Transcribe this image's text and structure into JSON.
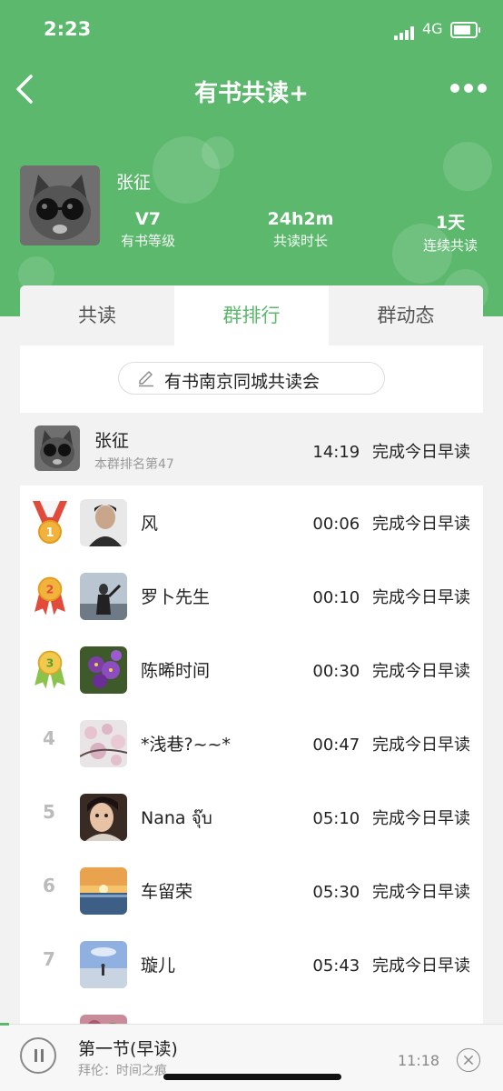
{
  "status_bar": {
    "time": "2:23",
    "network": "4G"
  },
  "nav": {
    "title": "有书共读+"
  },
  "profile": {
    "name": "张征",
    "stats": [
      {
        "value": "V7",
        "label": "有书等级"
      },
      {
        "value": "24h2m",
        "label": "共读时长"
      },
      {
        "value": "1天",
        "label": "连续共读"
      }
    ]
  },
  "tabs": [
    {
      "label": "共读",
      "active": false
    },
    {
      "label": "群排行",
      "active": true
    },
    {
      "label": "群动态",
      "active": false
    }
  ],
  "group_name": "有书南京同城共读会",
  "self_row": {
    "name": "张征",
    "rank_text": "本群排名第47",
    "time": "14:19",
    "status": "完成今日早读"
  },
  "ranking": [
    {
      "rank": "1",
      "name": "风",
      "time": "00:06",
      "status": "完成今日早读"
    },
    {
      "rank": "2",
      "name": "罗卜先生",
      "time": "00:10",
      "status": "完成今日早读"
    },
    {
      "rank": "3",
      "name": "陈晞时间",
      "time": "00:30",
      "status": "完成今日早读"
    },
    {
      "rank": "4",
      "name": "*浅巷?~~*",
      "time": "00:47",
      "status": "完成今日早读"
    },
    {
      "rank": "5",
      "name": "Nana จุ๊บ",
      "time": "05:10",
      "status": "完成今日早读"
    },
    {
      "rank": "6",
      "name": "车留荣",
      "time": "05:30",
      "status": "完成今日早读"
    },
    {
      "rank": "7",
      "name": "璇儿",
      "time": "05:43",
      "status": "完成今日早读"
    }
  ],
  "player": {
    "title": "第一节(早读)",
    "subtitle": "拜伦：时间之痕",
    "time": "11:18"
  },
  "colors": {
    "brand_green": "#5bb86c",
    "gold": "#f2b33d",
    "silver_ribbon": "#e24b3b",
    "bronze_ribbon": "#8bc34a"
  }
}
